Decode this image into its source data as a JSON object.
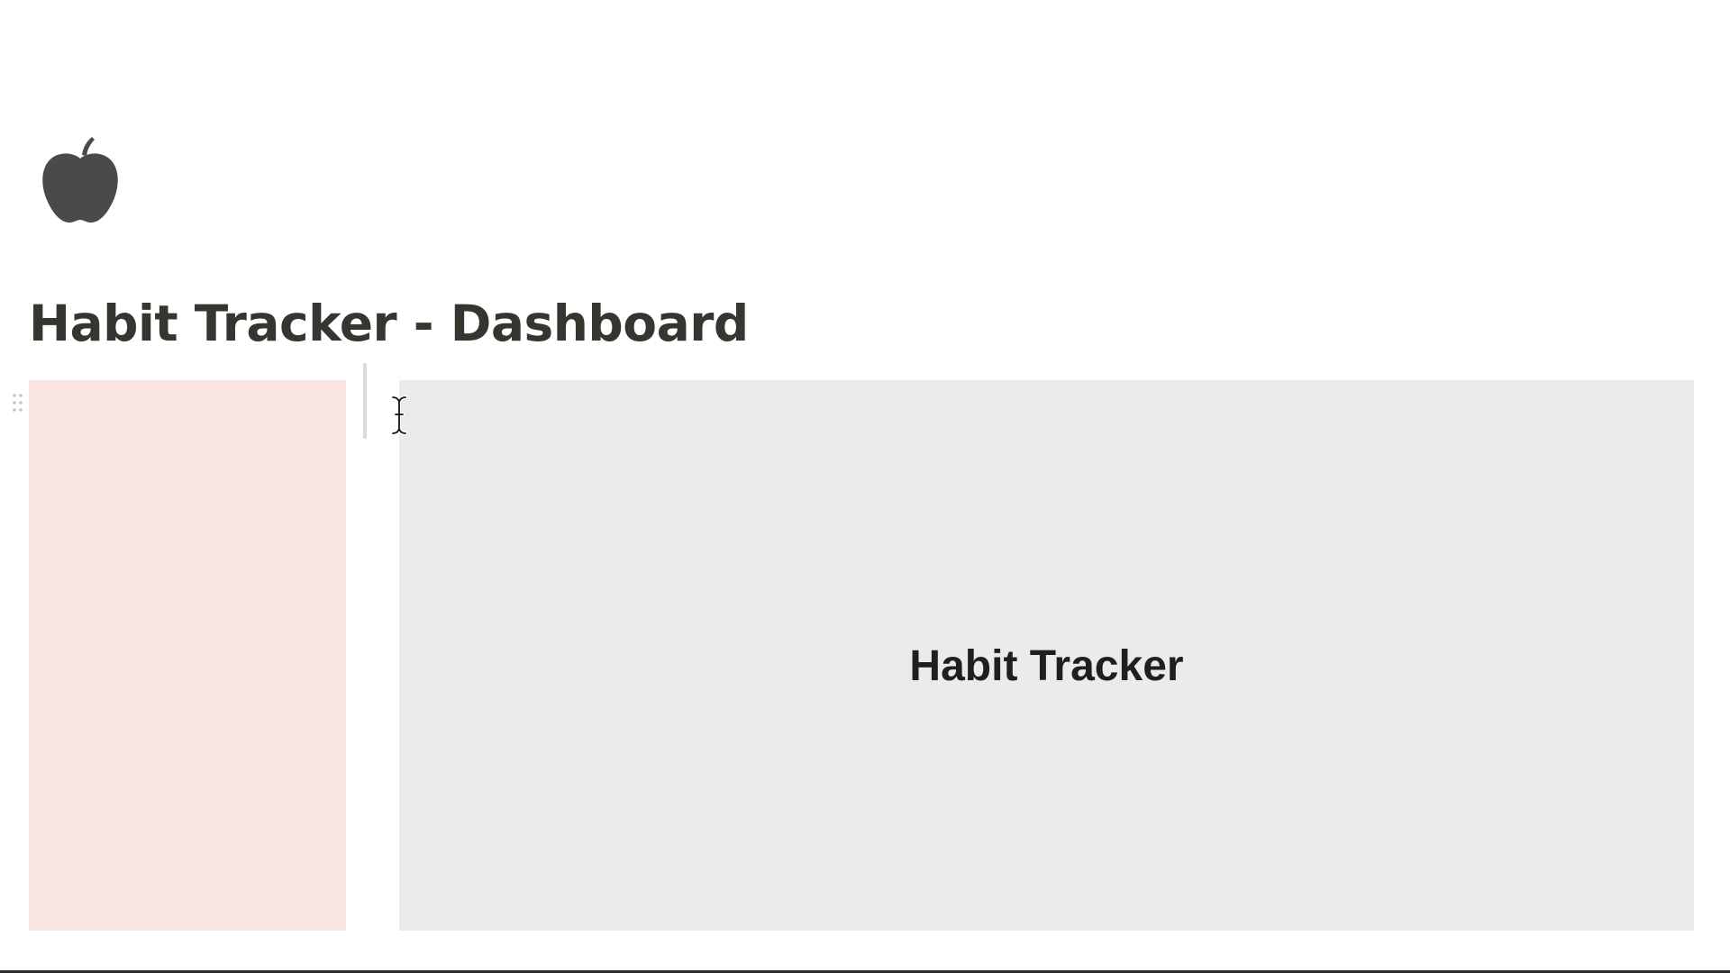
{
  "page": {
    "icon": "apple-icon",
    "title": "Habit Tracker - Dashboard"
  },
  "blocks": {
    "left_block": {
      "color": "#f9e5e3"
    },
    "right_block": {
      "color": "#ebebeb",
      "title": "Habit Tracker"
    }
  },
  "icons": {
    "drag_handle": "drag-handle-icon",
    "cursor": "text-cursor-icon"
  }
}
